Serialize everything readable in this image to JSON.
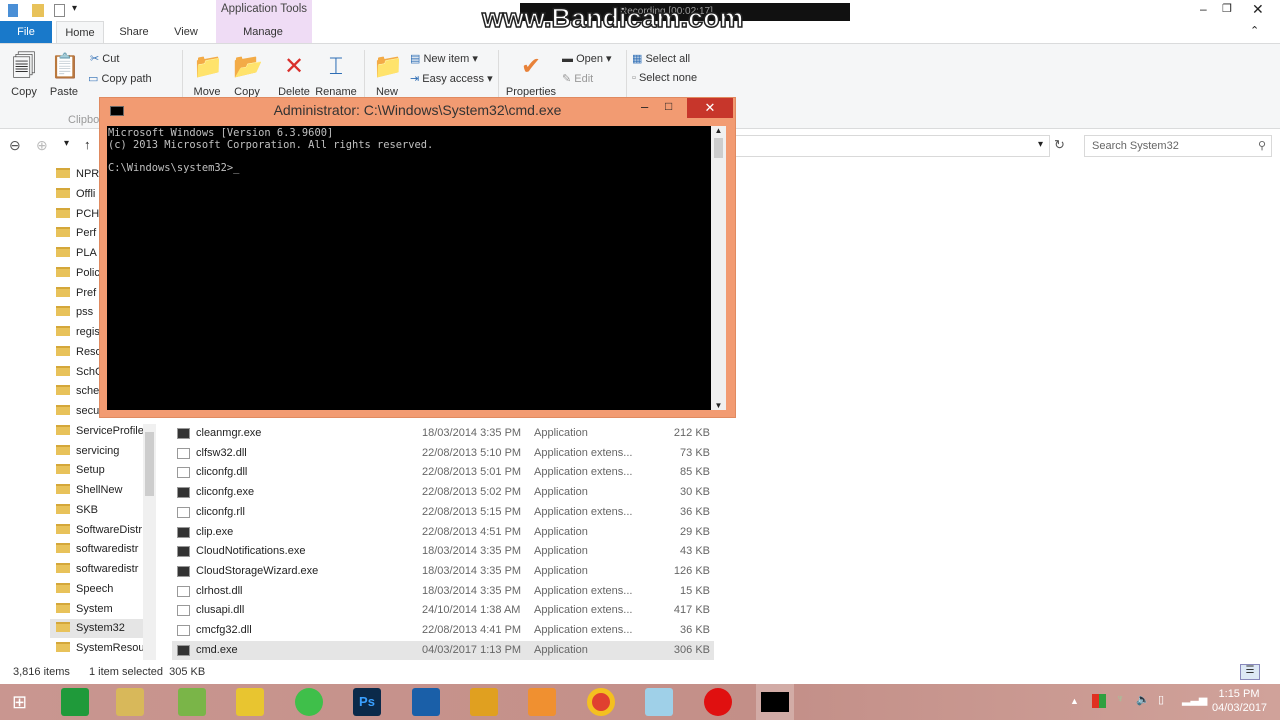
{
  "watermark": {
    "text": "www.Bandicam.com",
    "recording": "Recording [00:02:17]"
  },
  "ribbon": {
    "contextual_tab": "Application Tools",
    "tabs": [
      "File",
      "Home",
      "Share",
      "View",
      "Manage"
    ],
    "clipboard": {
      "copy": "Copy",
      "paste": "Paste",
      "cut": "Cut",
      "copy_path": "Copy path",
      "group": "Clipboard"
    },
    "organize": {
      "move": "Move",
      "copy": "Copy",
      "delete": "Delete",
      "rename": "Rename"
    },
    "new": {
      "new": "New",
      "new_item": "New item ▾",
      "easy_access": "Easy access ▾"
    },
    "open": {
      "properties": "Properties",
      "open": "Open ▾",
      "edit": "Edit"
    },
    "select": {
      "select_all": "Select all",
      "select_none": "Select none"
    }
  },
  "address": {
    "search_placeholder": "Search System32"
  },
  "nav": [
    "NPR",
    "Offli",
    "PCH",
    "Perf",
    "PLA",
    "Polic",
    "Pref",
    "pss",
    "regis",
    "Reso",
    "SchC",
    "sche",
    "secu",
    "ServiceProfiles",
    "servicing",
    "Setup",
    "ShellNew",
    "SKB",
    "SoftwareDistr",
    "softwaredistr",
    "softwaredistr",
    "Speech",
    "System",
    "System32",
    "SystemResou"
  ],
  "files": [
    {
      "name": "cleanmgr.exe",
      "date": "18/03/2014 3:35 PM",
      "type": "Application",
      "size": "212 KB"
    },
    {
      "name": "clfsw32.dll",
      "date": "22/08/2013 5:10 PM",
      "type": "Application extens...",
      "size": "73 KB"
    },
    {
      "name": "cliconfg.dll",
      "date": "22/08/2013 5:01 PM",
      "type": "Application extens...",
      "size": "85 KB"
    },
    {
      "name": "cliconfg.exe",
      "date": "22/08/2013 5:02 PM",
      "type": "Application",
      "size": "30 KB"
    },
    {
      "name": "cliconfg.rll",
      "date": "22/08/2013 5:15 PM",
      "type": "Application extens...",
      "size": "36 KB"
    },
    {
      "name": "clip.exe",
      "date": "22/08/2013 4:51 PM",
      "type": "Application",
      "size": "29 KB"
    },
    {
      "name": "CloudNotifications.exe",
      "date": "18/03/2014 3:35 PM",
      "type": "Application",
      "size": "43 KB"
    },
    {
      "name": "CloudStorageWizard.exe",
      "date": "18/03/2014 3:35 PM",
      "type": "Application",
      "size": "126 KB"
    },
    {
      "name": "clrhost.dll",
      "date": "18/03/2014 3:35 PM",
      "type": "Application extens...",
      "size": "15 KB"
    },
    {
      "name": "clusapi.dll",
      "date": "24/10/2014 1:38 AM",
      "type": "Application extens...",
      "size": "417 KB"
    },
    {
      "name": "cmcfg32.dll",
      "date": "22/08/2013 4:41 PM",
      "type": "Application extens...",
      "size": "36 KB"
    },
    {
      "name": "cmd.exe",
      "date": "04/03/2017 1:13 PM",
      "type": "Application",
      "size": "306 KB"
    }
  ],
  "status": {
    "items": "3,816 items",
    "selected": "1 item selected  305 KB"
  },
  "cmd": {
    "title": "Administrator: C:\\Windows\\System32\\cmd.exe",
    "lines": "Microsoft Windows [Version 6.3.9600]\n(c) 2013 Microsoft Corporation. All rights reserved.\n\nC:\\Windows\\system32>_"
  },
  "taskbar": {
    "time": "1:15 PM",
    "date": "04/03/2017",
    "color": "#c99690"
  }
}
